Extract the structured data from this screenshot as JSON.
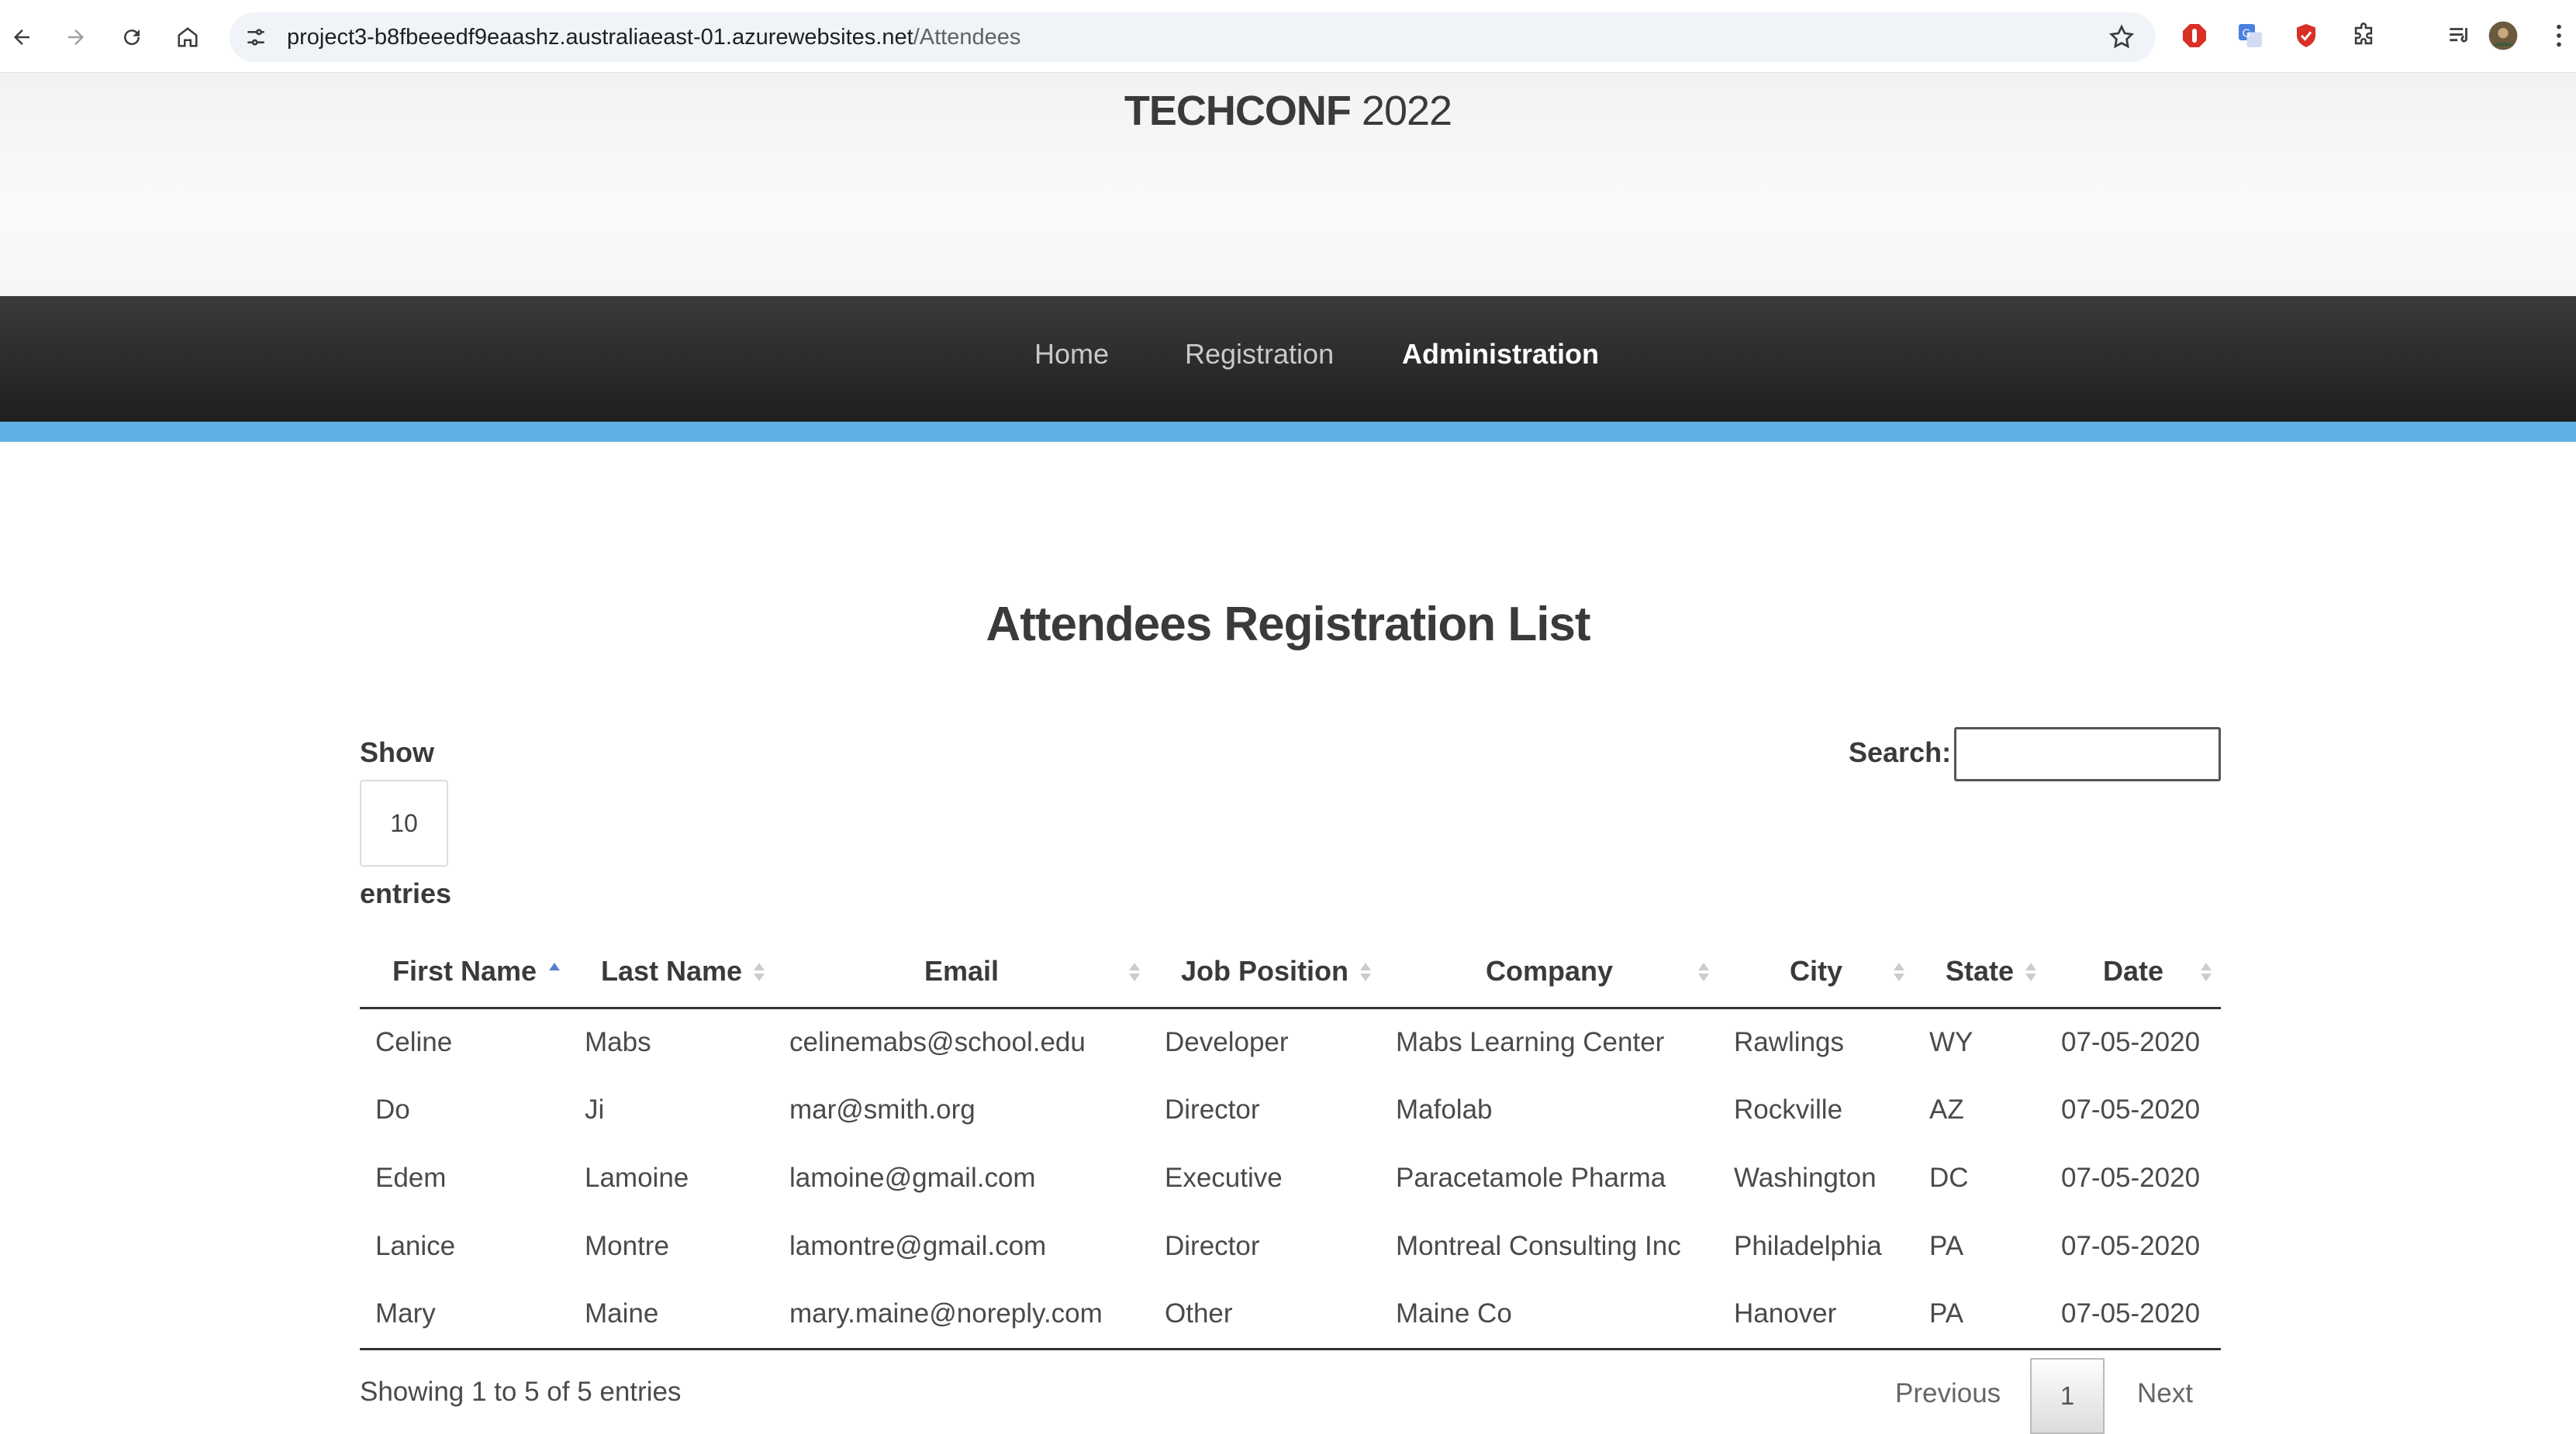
{
  "browser": {
    "url_host": "project3-b8fbeeedf9eaashz.australiaeast-01.azurewebsites.net",
    "url_path": "/Attendees"
  },
  "site": {
    "brand_bold": "TECHCONF",
    "brand_year": "2022",
    "nav": [
      {
        "label": "Home"
      },
      {
        "label": "Registration"
      },
      {
        "label": "Administration"
      }
    ],
    "active_nav": "Administration"
  },
  "page": {
    "title": "Attendees Registration List",
    "show_label": "Show",
    "entries_label": "entries",
    "length_value": "10",
    "search_label": "Search:",
    "search_value": ""
  },
  "table": {
    "columns": [
      "First Name",
      "Last Name",
      "Email",
      "Job Position",
      "Company",
      "City",
      "State",
      "Date"
    ],
    "sorted_column": "First Name",
    "sort_direction": "ascending",
    "rows": [
      [
        "Celine",
        "Mabs",
        "celinemabs@school.edu",
        "Developer",
        "Mabs Learning Center",
        "Rawlings",
        "WY",
        "07-05-2020"
      ],
      [
        "Do",
        "Ji",
        "mar@smith.org",
        "Director",
        "Mafolab",
        "Rockville",
        "AZ",
        "07-05-2020"
      ],
      [
        "Edem",
        "Lamoine",
        "lamoine@gmail.com",
        "Executive",
        "Paracetamole Pharma",
        "Washington",
        "DC",
        "07-05-2020"
      ],
      [
        "Lanice",
        "Montre",
        "lamontre@gmail.com",
        "Director",
        "Montreal Consulting Inc",
        "Philadelphia",
        "PA",
        "07-05-2020"
      ],
      [
        "Mary",
        "Maine",
        "mary.maine@noreply.com",
        "Other",
        "Maine Co",
        "Hanover",
        "PA",
        "07-05-2020"
      ]
    ]
  },
  "footer": {
    "info": "Showing 1 to 5 of 5 entries",
    "previous": "Previous",
    "current_page": "1",
    "next": "Next"
  },
  "colors": {
    "accent": "#5fb0e4",
    "navbar": "#262626"
  }
}
